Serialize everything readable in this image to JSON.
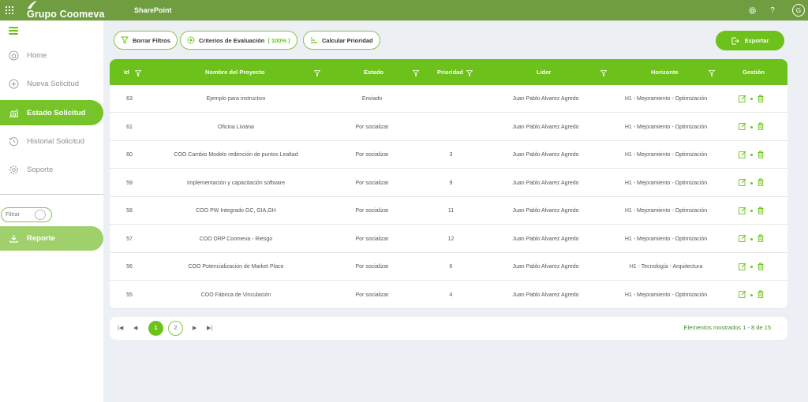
{
  "topbar": {
    "brand": "Grupo Coomeva",
    "app_title": "SharePoint",
    "avatar": "G"
  },
  "sidebar": {
    "items": [
      {
        "label": "Home",
        "icon": "home-icon",
        "active": false
      },
      {
        "label": "Nueva Solicitud",
        "icon": "plus-circle-icon",
        "active": false
      },
      {
        "label": "Estado Solicitud",
        "icon": "chart-icon",
        "active": true
      },
      {
        "label": "Historial Solicitud",
        "icon": "history-icon",
        "active": false
      },
      {
        "label": "Soporte",
        "icon": "gear-icon",
        "active": false
      }
    ],
    "filter_label": "Filtrar",
    "report_label": "Reporte"
  },
  "toolbar": {
    "clear_filters": "Borrar Filtros",
    "criteria": "Criterios de Evaluación",
    "criteria_pct": "( 100% )",
    "calc_priority": "Calcular Prioridad",
    "export": "Exportar"
  },
  "table": {
    "headers": {
      "id": "Id",
      "name": "Nombre del Proyecto",
      "status": "Estado",
      "priority": "Prioridad",
      "leader": "Lider",
      "horizon": "Horizonte",
      "actions": "Gestión"
    },
    "rows": [
      {
        "id": "63",
        "name": "Ejemplo para instructivo",
        "status": "Enviado",
        "priority": "",
        "leader": "Juan Pablo Alvarez Agredo",
        "horizon": "H1 - Mejoramiento - Optimización"
      },
      {
        "id": "61",
        "name": "Oficina Liviana",
        "status": "Por socializar",
        "priority": "",
        "leader": "Juan Pablo Alvarez Agredo",
        "horizon": "H1 - Mejoramiento - Optimización"
      },
      {
        "id": "60",
        "name": "COO Cambio Modelo redención de puntos Lealtad",
        "status": "Por socializar",
        "priority": "3",
        "leader": "Juan Pablo Alvarez Agredo",
        "horizon": "H1 - Mejoramiento - Optimización"
      },
      {
        "id": "59",
        "name": "Implementación y capacitación software",
        "status": "Por socializar",
        "priority": "9",
        "leader": "Juan Pablo Alvarez Agredo",
        "horizon": "H1 - Mejoramiento - Optimización"
      },
      {
        "id": "58",
        "name": "COO PW Integrado GC, GIA,GH",
        "status": "Por socializar",
        "priority": "11",
        "leader": "Juan Pablo Alvarez Agredo",
        "horizon": "H1 - Mejoramiento - Optimización"
      },
      {
        "id": "57",
        "name": "COO DRP Coomeva - Riesgo",
        "status": "Por socializar",
        "priority": "12",
        "leader": "Juan Pablo Alvarez Agredo",
        "horizon": "H1 - Mejoramiento - Optimización"
      },
      {
        "id": "56",
        "name": "COO Potencializacion de Market Place",
        "status": "Por socializar",
        "priority": "6",
        "leader": "Juan Pablo Alvarez Agredo",
        "horizon": "H1 - Tecnología - Arquitectura"
      },
      {
        "id": "55",
        "name": "COO Fábrica de Vinculación",
        "status": "Por socializar",
        "priority": "4",
        "leader": "Juan Pablo Alvarez Agredo",
        "horizon": "H1 - Mejoramiento - Optimización"
      }
    ]
  },
  "pager": {
    "pages": [
      "1",
      "2"
    ],
    "current": "1",
    "info": "Elementos mostrados 1 - 8 de 15"
  },
  "colors": {
    "topbar": "#6f9d3f",
    "accent": "#6cc21a",
    "accent_light": "#9fd06c"
  }
}
